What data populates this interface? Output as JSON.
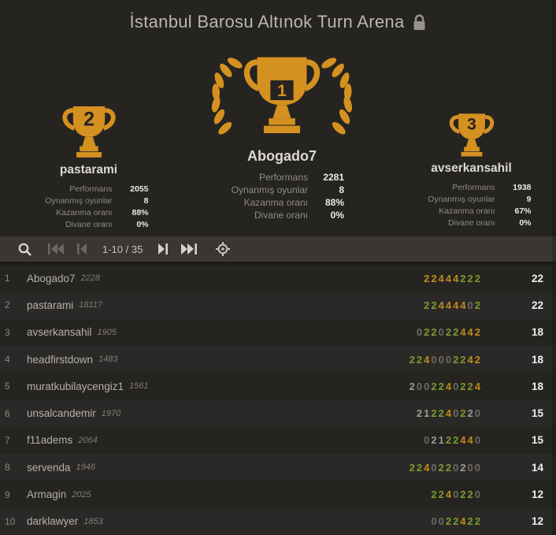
{
  "header": {
    "title": "İstanbul Barosu Altınok Turn Arena"
  },
  "podium": {
    "first": {
      "number": "1",
      "name": "Abogado7",
      "stats": [
        {
          "label": "Performans",
          "value": "2281"
        },
        {
          "label": "Oynanmış oyunlar",
          "value": "8"
        },
        {
          "label": "Kazanma oranı",
          "value": "88%"
        },
        {
          "label": "Divane oranı",
          "value": "0%"
        }
      ]
    },
    "second": {
      "number": "2",
      "name": "pastarami",
      "stats": [
        {
          "label": "Performans",
          "value": "2055"
        },
        {
          "label": "Oynanmış oyunlar",
          "value": "8"
        },
        {
          "label": "Kazanma oranı",
          "value": "88%"
        },
        {
          "label": "Divane oranı",
          "value": "0%"
        }
      ]
    },
    "third": {
      "number": "3",
      "name": "avserkansahil",
      "stats": [
        {
          "label": "Performans",
          "value": "1938"
        },
        {
          "label": "Oynanmış oyunlar",
          "value": "9"
        },
        {
          "label": "Kazanma oranı",
          "value": "67%"
        },
        {
          "label": "Divane oranı",
          "value": "0%"
        }
      ]
    }
  },
  "toolbar": {
    "pagination": "1-10 / 35"
  },
  "standings": {
    "rows": [
      {
        "rank": "1",
        "name": "Abogado7",
        "rating": "2228",
        "total": "22",
        "scores": [
          [
            "2",
            "o"
          ],
          [
            "2",
            "o"
          ],
          [
            "4",
            "o"
          ],
          [
            "4",
            "o"
          ],
          [
            "4",
            "o"
          ],
          [
            "2",
            "g"
          ],
          [
            "2",
            "g"
          ],
          [
            "2",
            "g"
          ]
        ]
      },
      {
        "rank": "2",
        "name": "pastarami",
        "rating": "1811?",
        "total": "22",
        "scores": [
          [
            "2",
            "g"
          ],
          [
            "2",
            "g"
          ],
          [
            "4",
            "o"
          ],
          [
            "4",
            "o"
          ],
          [
            "4",
            "o"
          ],
          [
            "4",
            "o"
          ],
          [
            "0",
            "x"
          ],
          [
            "2",
            "g"
          ]
        ]
      },
      {
        "rank": "3",
        "name": "avserkansahil",
        "rating": "1905",
        "total": "18",
        "scores": [
          [
            "0",
            "x"
          ],
          [
            "2",
            "g"
          ],
          [
            "2",
            "g"
          ],
          [
            "0",
            "x"
          ],
          [
            "2",
            "g"
          ],
          [
            "2",
            "g"
          ],
          [
            "4",
            "o"
          ],
          [
            "4",
            "o"
          ],
          [
            "2",
            "o"
          ]
        ]
      },
      {
        "rank": "4",
        "name": "headfirstdown",
        "rating": "1483",
        "total": "18",
        "scores": [
          [
            "2",
            "g"
          ],
          [
            "2",
            "g"
          ],
          [
            "4",
            "o"
          ],
          [
            "0",
            "x"
          ],
          [
            "0",
            "x"
          ],
          [
            "0",
            "x"
          ],
          [
            "2",
            "g"
          ],
          [
            "2",
            "g"
          ],
          [
            "4",
            "o"
          ],
          [
            "2",
            "o"
          ]
        ]
      },
      {
        "rank": "5",
        "name": "muratkubilaycengiz1",
        "rating": "1561",
        "total": "18",
        "scores": [
          [
            "2",
            "w"
          ],
          [
            "0",
            "x"
          ],
          [
            "0",
            "x"
          ],
          [
            "2",
            "g"
          ],
          [
            "2",
            "g"
          ],
          [
            "4",
            "o"
          ],
          [
            "0",
            "x"
          ],
          [
            "2",
            "g"
          ],
          [
            "2",
            "g"
          ],
          [
            "4",
            "o"
          ]
        ]
      },
      {
        "rank": "6",
        "name": "unsalcandemir",
        "rating": "1970",
        "total": "15",
        "scores": [
          [
            "2",
            "w"
          ],
          [
            "1",
            "w"
          ],
          [
            "2",
            "g"
          ],
          [
            "2",
            "g"
          ],
          [
            "4",
            "o"
          ],
          [
            "0",
            "x"
          ],
          [
            "2",
            "g"
          ],
          [
            "2",
            "w"
          ],
          [
            "0",
            "x"
          ]
        ]
      },
      {
        "rank": "7",
        "name": "f11adems",
        "rating": "2064",
        "total": "15",
        "scores": [
          [
            "0",
            "x"
          ],
          [
            "2",
            "w"
          ],
          [
            "1",
            "w"
          ],
          [
            "2",
            "g"
          ],
          [
            "2",
            "g"
          ],
          [
            "4",
            "o"
          ],
          [
            "4",
            "o"
          ],
          [
            "0",
            "x"
          ]
        ]
      },
      {
        "rank": "8",
        "name": "servenda",
        "rating": "1946",
        "total": "14",
        "scores": [
          [
            "2",
            "g"
          ],
          [
            "2",
            "g"
          ],
          [
            "4",
            "o"
          ],
          [
            "0",
            "x"
          ],
          [
            "2",
            "g"
          ],
          [
            "2",
            "g"
          ],
          [
            "0",
            "x"
          ],
          [
            "2",
            "w"
          ],
          [
            "0",
            "x"
          ],
          [
            "0",
            "x"
          ]
        ]
      },
      {
        "rank": "9",
        "name": "Armagin",
        "rating": "2025",
        "total": "12",
        "scores": [
          [
            "2",
            "g"
          ],
          [
            "2",
            "g"
          ],
          [
            "4",
            "o"
          ],
          [
            "0",
            "x"
          ],
          [
            "2",
            "g"
          ],
          [
            "2",
            "g"
          ],
          [
            "0",
            "x"
          ]
        ]
      },
      {
        "rank": "10",
        "name": "darklawyer",
        "rating": "1853",
        "total": "12",
        "scores": [
          [
            "0",
            "x"
          ],
          [
            "0",
            "x"
          ],
          [
            "2",
            "g"
          ],
          [
            "2",
            "g"
          ],
          [
            "4",
            "o"
          ],
          [
            "2",
            "g"
          ],
          [
            "2",
            "g"
          ]
        ]
      }
    ]
  },
  "colors": {
    "g": "#7d9b2e",
    "o": "#bf8b1e",
    "x": "#6e6a64",
    "w": "#9d9994",
    "gold": "#d59120",
    "trophy_dark": "#262421"
  }
}
